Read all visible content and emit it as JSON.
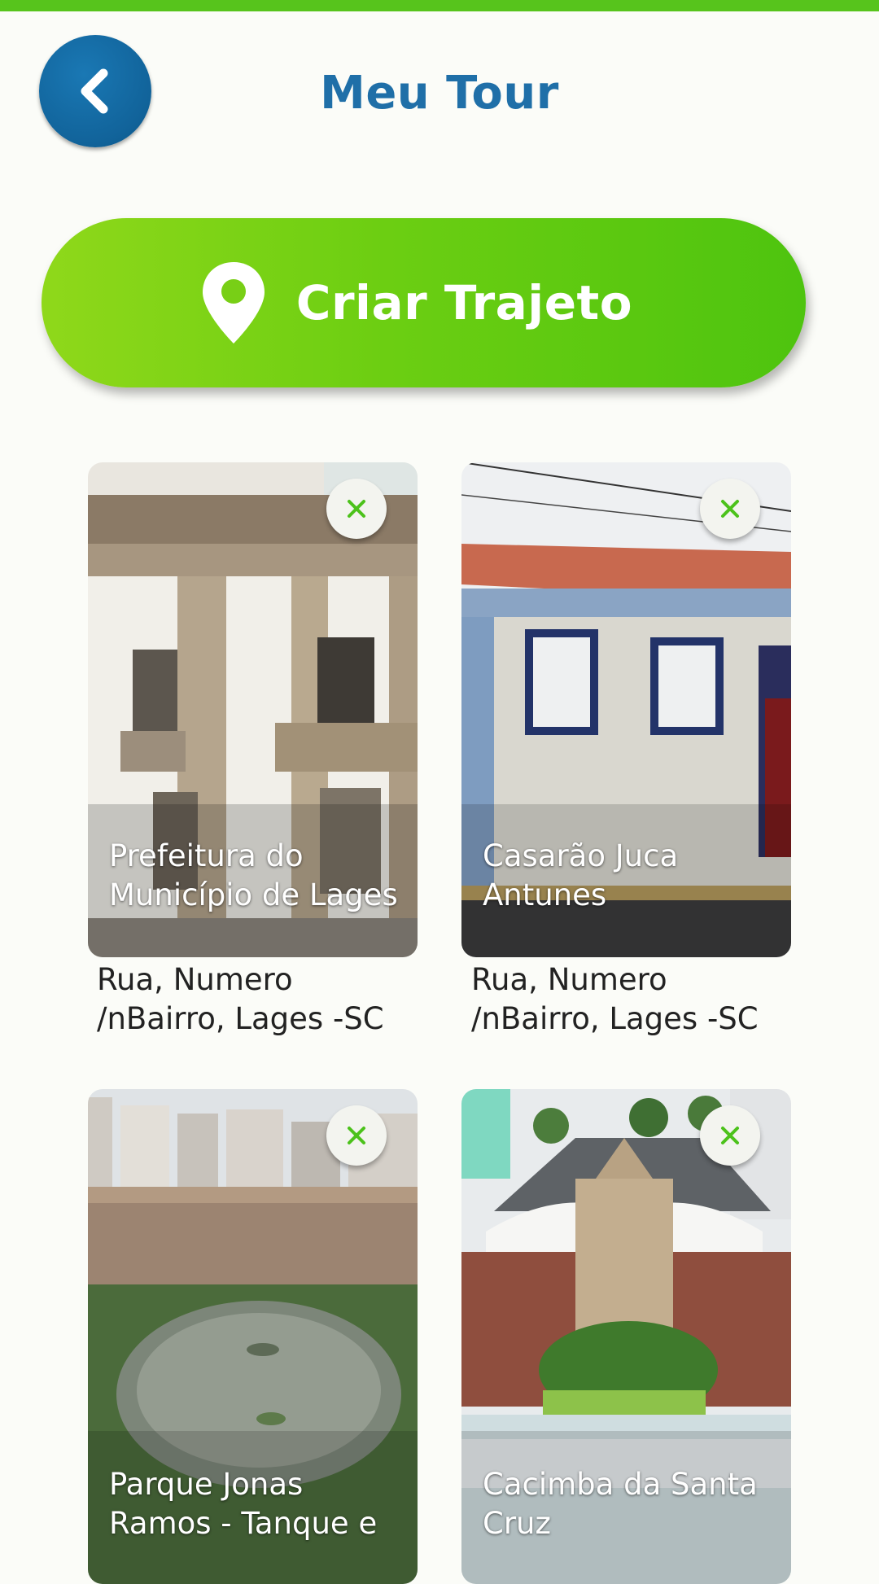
{
  "header": {
    "title": "Meu Tour",
    "back_icon": "chevron-left-icon"
  },
  "cta": {
    "label": "Criar Trajeto",
    "icon": "map-pin-icon"
  },
  "colors": {
    "accent_green": "#57c41c",
    "title_blue": "#1f6fa8",
    "back_button": "#11639a",
    "remove_x": "#4cc21b"
  },
  "cards": [
    {
      "title": "Prefeitura do Município de Lages",
      "address": "Rua, Numero /nBairro, Lages -SC",
      "remove_icon": "close-icon"
    },
    {
      "title": "Casarão Juca Antunes",
      "address": "Rua, Numero /nBairro, Lages -SC",
      "remove_icon": "close-icon"
    },
    {
      "title": "Parque Jonas Ramos - Tanque e",
      "remove_icon": "close-icon"
    },
    {
      "title": "Cacimba da Santa Cruz",
      "remove_icon": "close-icon"
    }
  ]
}
